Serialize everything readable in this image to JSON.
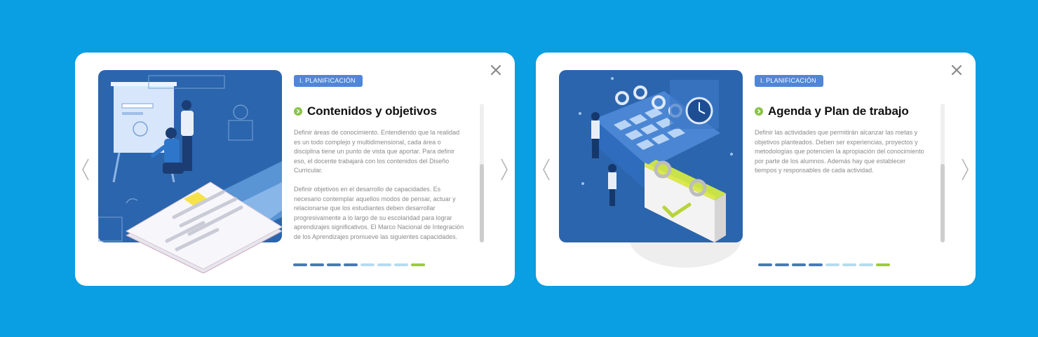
{
  "cards": [
    {
      "tag": "I. PLANIFICACIÓN",
      "title": "Contenidos y objetivos",
      "paragraphs": [
        "Definir áreas de conocimiento. Entendiendo que la realidad es un todo complejo y multidimensional, cada área o disciplina tiene un punto de vista que aportar. Para definir eso, el docente trabajará con los contenidos del Diseño Curricular.",
        "Definir objetivos en el desarrollo de capacidades. Es necesario contemplar aquellos modos de pensar, actuar y relacionarse que los estudiantes deben desarrollar progresivamente a lo largo de su escolaridad para lograr aprendizajes significativos. El Marco Nacional de Integración de los Aprendizajes promueve las siguientes capacidades."
      ],
      "close_icon": "close-icon",
      "prev_icon": "chevron-left-icon",
      "next_icon": "chevron-right-icon",
      "pagination": {
        "total": 8,
        "active": 7,
        "visited": 4
      }
    },
    {
      "tag": "I. PLANIFICACIÓN",
      "title": "Agenda y Plan de trabajo",
      "paragraphs": [
        "Definir las actividades que permitirán alcanzar las metas y objetivos planteados. Deben ser experiencias, proyectos y metodologías que potencien la apropiación del conocimiento por parte de los alumnos. Además hay que establecer tiempos y responsables de cada actividad."
      ],
      "close_icon": "close-icon",
      "prev_icon": "chevron-left-icon",
      "next_icon": "chevron-right-icon",
      "pagination": {
        "total": 8,
        "active": 7,
        "visited": 4
      }
    }
  ],
  "colors": {
    "background": "#0a9ee2",
    "card": "#ffffff",
    "tag": "#4f86d9",
    "bullet": "#8bc34a",
    "dot_visited": "#4a79b8",
    "dot_pending": "#b7dbf0",
    "dot_active": "#9ccc3c",
    "illustration_bg": "#2b65ad"
  }
}
